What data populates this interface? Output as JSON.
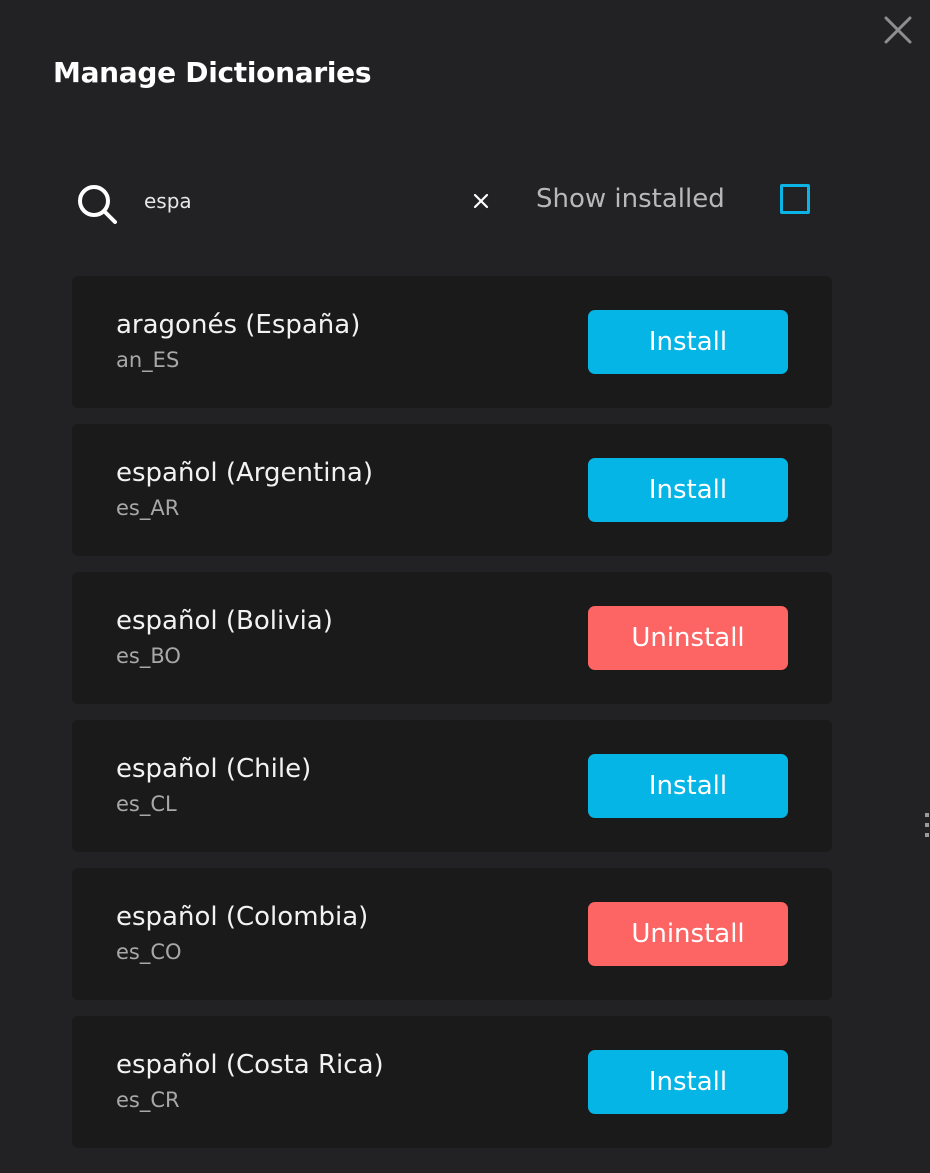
{
  "dialog": {
    "title": "Manage Dictionaries",
    "close_icon": "close-icon"
  },
  "search": {
    "icon": "search-icon",
    "value": "espa",
    "placeholder": "",
    "clear_icon": "clear-icon"
  },
  "filter": {
    "show_installed_label": "Show installed",
    "show_installed_checked": false
  },
  "colors": {
    "background": "#222224",
    "card": "#1a1a1b",
    "install": "#05b5e6",
    "uninstall": "#fd6464",
    "accent": "#0bb4e4"
  },
  "dictionaries": [
    {
      "name": "aragonés (España)",
      "code": "an_ES",
      "action": "Install",
      "installed": false
    },
    {
      "name": "español (Argentina)",
      "code": "es_AR",
      "action": "Install",
      "installed": false
    },
    {
      "name": "español (Bolivia)",
      "code": "es_BO",
      "action": "Uninstall",
      "installed": true
    },
    {
      "name": "español (Chile)",
      "code": "es_CL",
      "action": "Install",
      "installed": false
    },
    {
      "name": "español (Colombia)",
      "code": "es_CO",
      "action": "Uninstall",
      "installed": true
    },
    {
      "name": "español (Costa Rica)",
      "code": "es_CR",
      "action": "Install",
      "installed": false
    }
  ]
}
